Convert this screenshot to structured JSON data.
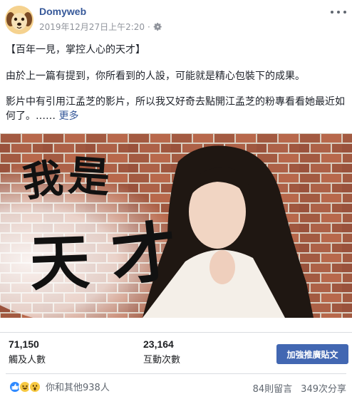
{
  "post": {
    "page_name": "Domyweb",
    "timestamp": "2019年12月27日上午2:20",
    "separator": "·",
    "audience_icon": "gear-icon",
    "more_icon": "more-options-icon",
    "paragraphs": [
      "【百年一見，掌控人心的天才】",
      "由於上一篇有提到，你所看到的人設，可能就是精心包裝下的成果。",
      "影片中有引用江孟芝的影片，所以我又好奇去點開江孟芝的粉專看看她最近如何了。…… "
    ],
    "see_more": "更多",
    "image_caption_chars": [
      "我",
      "是",
      "天",
      "才"
    ]
  },
  "stats": {
    "reach_value": "71,150",
    "reach_label": "觸及人數",
    "engagement_value": "23,164",
    "engagement_label": "互動次數",
    "boost_label": "加強推廣貼文"
  },
  "reactions": {
    "icons": [
      "like-icon",
      "haha-icon",
      "wow-icon"
    ],
    "summary": "你和其他938人",
    "comments": "84則留言",
    "shares": "349次分享"
  },
  "colors": {
    "link_blue": "#365899",
    "button_blue": "#4267b2",
    "meta_gray": "#90949c"
  }
}
